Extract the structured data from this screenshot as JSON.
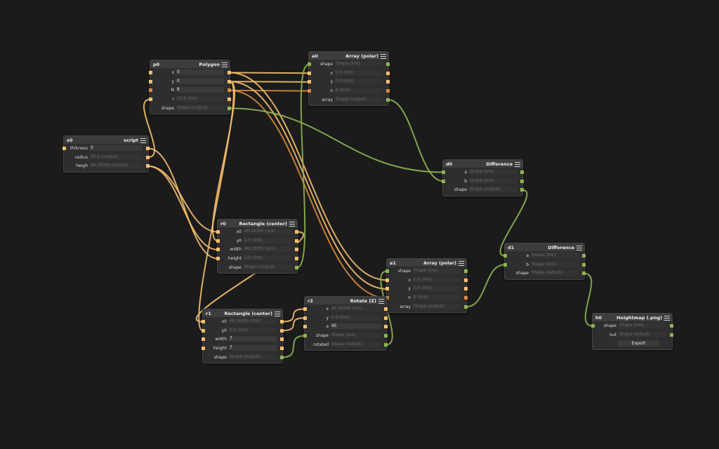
{
  "colors": {
    "background": "#1b1b1b",
    "number": "#f5bf6e",
    "integer": "#d9893a",
    "shape": "#8fb453"
  },
  "nodes": [
    {
      "key": "p0",
      "id": "p0",
      "title": "Polygon",
      "rows": [
        {
          "label": "x",
          "value": "0",
          "in": "number",
          "out": "number"
        },
        {
          "label": "y",
          "value": "0",
          "in": "number",
          "out": "number"
        },
        {
          "label": "N",
          "value": "8",
          "in": "integer",
          "out": "integer"
        },
        {
          "label": "r",
          "value": "50.0 (link)",
          "link": true,
          "in": "number",
          "out": "number"
        },
        {
          "label": "shape",
          "value": "Shape (output)",
          "link": true,
          "out": "shape"
        }
      ]
    },
    {
      "key": "a0",
      "id": "a0",
      "title": "Array (polar)",
      "rows": [
        {
          "label": "shape",
          "value": "Shape (link)",
          "link": true,
          "in": "shape",
          "out": "shape"
        },
        {
          "label": "x",
          "value": "0.0 (link)",
          "link": true,
          "in": "number",
          "out": "number"
        },
        {
          "label": "y",
          "value": "0.0 (link)",
          "link": true,
          "in": "number",
          "out": "number"
        },
        {
          "label": "n",
          "value": "8 (link)",
          "link": true,
          "in": "integer",
          "out": "integer"
        },
        {
          "label": "array",
          "value": "Shape (output)",
          "link": true,
          "out": "shape"
        }
      ]
    },
    {
      "key": "s0",
      "id": "s0",
      "title": "script",
      "rows": [
        {
          "label": "thikness",
          "value": "5",
          "in": "number",
          "out": "number"
        },
        {
          "label": "radius",
          "value": "50.0 (output)",
          "link": true,
          "out": "number"
        },
        {
          "label": "heigh",
          "value": "46.19395 (output)",
          "link": true,
          "out": "number"
        }
      ]
    },
    {
      "key": "d0",
      "id": "d0",
      "title": "Difference",
      "rows": [
        {
          "label": "a",
          "value": "Shape (link)",
          "link": true,
          "in": "shape",
          "out": "shape"
        },
        {
          "label": "b",
          "value": "Shape (link)",
          "link": true,
          "in": "shape",
          "out": "shape"
        },
        {
          "label": "shape",
          "value": "Shape (output)",
          "link": true,
          "out": "shape"
        }
      ]
    },
    {
      "key": "r0",
      "id": "r0",
      "title": "Rectangle (center)",
      "rows": [
        {
          "label": "x0",
          "value": "46.19395 (link)",
          "link": true,
          "in": "number",
          "out": "number"
        },
        {
          "label": "y0",
          "value": "0.0 (link)",
          "link": true,
          "in": "number",
          "out": "number"
        },
        {
          "label": "width",
          "value": "46.19395 (link)",
          "link": true,
          "in": "number",
          "out": "number"
        },
        {
          "label": "height",
          "value": "5.0 (link)",
          "link": true,
          "in": "number",
          "out": "number"
        },
        {
          "label": "shape",
          "value": "Shape (output)",
          "link": true,
          "out": "shape"
        }
      ]
    },
    {
      "key": "d1",
      "id": "d1",
      "title": "Difference",
      "rows": [
        {
          "label": "a",
          "value": "Shape (link)",
          "link": true,
          "in": "shape",
          "out": "shape"
        },
        {
          "label": "b",
          "value": "Shape (link)",
          "link": true,
          "in": "shape",
          "out": "shape"
        },
        {
          "label": "shape",
          "value": "Shape (output)",
          "link": true,
          "out": "shape"
        }
      ]
    },
    {
      "key": "a1",
      "id": "a1",
      "title": "Array (polar)",
      "rows": [
        {
          "label": "shape",
          "value": "Shape (link)",
          "link": true,
          "in": "shape",
          "out": "shape"
        },
        {
          "label": "x",
          "value": "0.0 (link)",
          "link": true,
          "in": "number",
          "out": "number"
        },
        {
          "label": "y",
          "value": "0.0 (link)",
          "link": true,
          "in": "number",
          "out": "number"
        },
        {
          "label": "n",
          "value": "8 (link)",
          "link": true,
          "in": "integer",
          "out": "integer"
        },
        {
          "label": "array",
          "value": "Shape (output)",
          "link": true,
          "out": "shape"
        }
      ]
    },
    {
      "key": "r2",
      "id": "r2",
      "title": "Rotate (Z)",
      "rows": [
        {
          "label": "x",
          "value": "46.19395 (link)",
          "link": true,
          "in": "number",
          "out": "number"
        },
        {
          "label": "y",
          "value": "0.0 (link)",
          "link": true,
          "in": "number",
          "out": "number"
        },
        {
          "label": "a",
          "value": "45",
          "in": "number",
          "out": "number"
        },
        {
          "label": "shape",
          "value": "Shape (link)",
          "link": true,
          "in": "shape",
          "out": "shape"
        },
        {
          "label": "rotated",
          "value": "Shape (output)",
          "link": true,
          "out": "shape"
        }
      ]
    },
    {
      "key": "r1",
      "id": "r1",
      "title": "Rectangle (center)",
      "rows": [
        {
          "label": "x0",
          "value": "46.19395 (link)",
          "link": true,
          "in": "number",
          "out": "number"
        },
        {
          "label": "y0",
          "value": "0.0 (link)",
          "link": true,
          "in": "number",
          "out": "number"
        },
        {
          "label": "width",
          "value": "7",
          "in": "number",
          "out": "number"
        },
        {
          "label": "height",
          "value": "7",
          "in": "number",
          "out": "number"
        },
        {
          "label": "shape",
          "value": "Shape (output)",
          "link": true,
          "out": "shape"
        }
      ]
    },
    {
      "key": "h0",
      "id": "h0",
      "title": "Heightmap (.png)",
      "rows": [
        {
          "label": "shape",
          "value": "Shape (link)",
          "link": true,
          "in": "shape",
          "out": "shape"
        },
        {
          "label": "out",
          "value": "Shape (output)",
          "link": true,
          "out": "shape"
        },
        {
          "button": "Export"
        }
      ]
    }
  ],
  "connections": [
    {
      "from": "p0.0",
      "to": "a0.1",
      "type": "number"
    },
    {
      "from": "p0.1",
      "to": "a0.2",
      "type": "number"
    },
    {
      "from": "p0.2",
      "to": "a0.3",
      "type": "integer"
    },
    {
      "from": "p0.0",
      "to": "a1.1",
      "type": "number"
    },
    {
      "from": "p0.1",
      "to": "a1.2",
      "type": "number"
    },
    {
      "from": "p0.2",
      "to": "a1.3",
      "type": "integer"
    },
    {
      "from": "s0.1",
      "to": "p0.3",
      "type": "number"
    },
    {
      "from": "s0.2",
      "to": "r0.0",
      "type": "number"
    },
    {
      "from": "s0.2",
      "to": "r0.2",
      "type": "number"
    },
    {
      "from": "s0.0",
      "to": "r0.3",
      "type": "number"
    },
    {
      "from": "p0.1",
      "to": "r0.1",
      "type": "number"
    },
    {
      "from": "p0.4",
      "to": "d0.0",
      "type": "shape"
    },
    {
      "from": "a0.4",
      "to": "d0.1",
      "type": "shape"
    },
    {
      "from": "r0.4",
      "to": "a0.0",
      "type": "shape"
    },
    {
      "from": "d0.2",
      "to": "d1.0",
      "type": "shape"
    },
    {
      "from": "a1.4",
      "to": "d1.1",
      "type": "shape"
    },
    {
      "from": "d1.2",
      "to": "h0.0",
      "type": "shape"
    },
    {
      "from": "r0.0",
      "to": "r1.0",
      "type": "number"
    },
    {
      "from": "p0.1",
      "to": "r1.1",
      "type": "number"
    },
    {
      "from": "r1.0",
      "to": "r2.0",
      "type": "number"
    },
    {
      "from": "r1.1",
      "to": "r2.1",
      "type": "number"
    },
    {
      "from": "r1.4",
      "to": "r2.3",
      "type": "shape"
    },
    {
      "from": "r2.4",
      "to": "a1.0",
      "type": "shape"
    }
  ]
}
